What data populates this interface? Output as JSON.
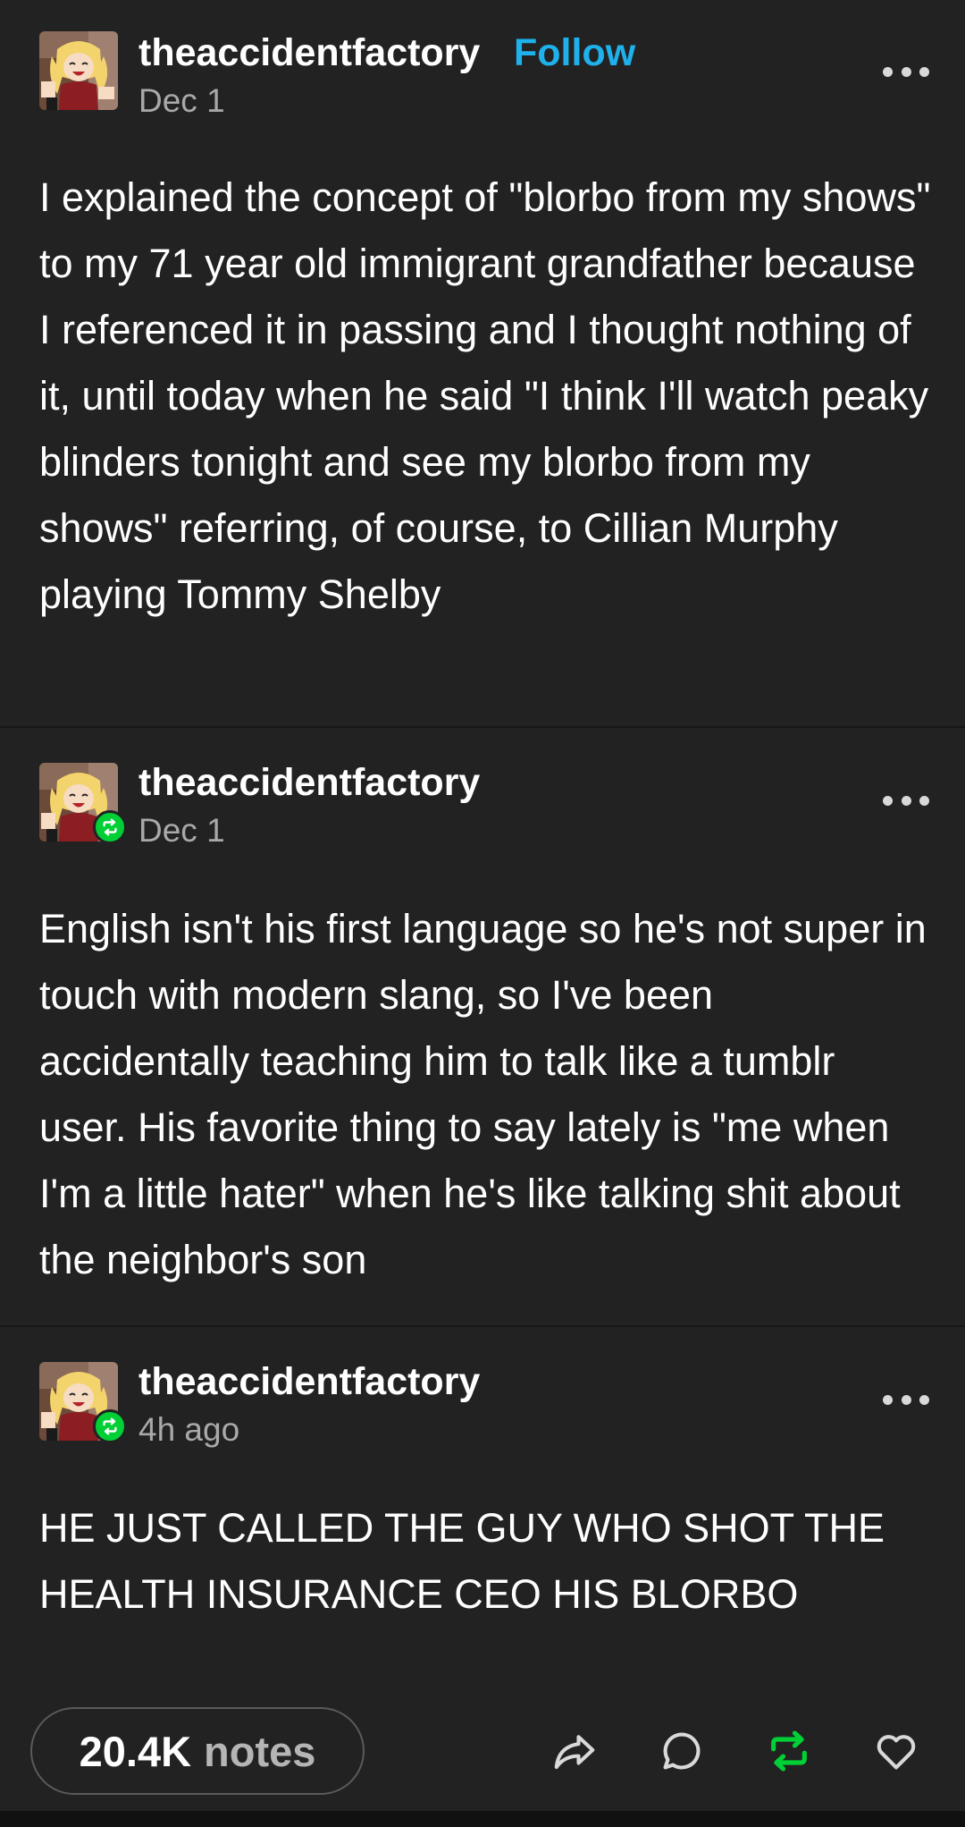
{
  "colors": {
    "background": "#222222",
    "text": "#ffffff",
    "secondary_text": "#a9a9a9",
    "follow_blue": "#1eb1ec",
    "reblog_green": "#00cf35"
  },
  "posts": [
    {
      "username": "theaccidentfactory",
      "follow_label": "Follow",
      "date": "Dec 1",
      "text": "I explained the concept of \"blorbo from my shows\" to my 71 year old immigrant grandfather because I referenced it in passing and I thought nothing of it, until today when he said \"I think I'll watch peaky blinders tonight and see my blorbo from my shows\" referring, of course, to Cillian Murphy playing Tommy Shelby"
    },
    {
      "username": "theaccidentfactory",
      "date": "Dec 1",
      "reblog_icon": "reblog-icon",
      "text": "English isn't his first language so he's not super in touch with modern slang, so I've been accidentally teaching him to talk like a tumblr user. His favorite thing to say lately is \"me when I'm a little hater\" when he's like talking shit about the neighbor's son"
    },
    {
      "username": "theaccidentfactory",
      "date": "4h ago",
      "reblog_icon": "reblog-icon",
      "text": "HE JUST CALLED THE GUY WHO SHOT THE HEALTH INSURANCE CEO HIS BLORBO"
    }
  ],
  "footer": {
    "notes_count": "20.4K",
    "notes_label": "notes",
    "actions": [
      "share-icon",
      "comment-icon",
      "reblog-icon",
      "heart-icon"
    ]
  }
}
